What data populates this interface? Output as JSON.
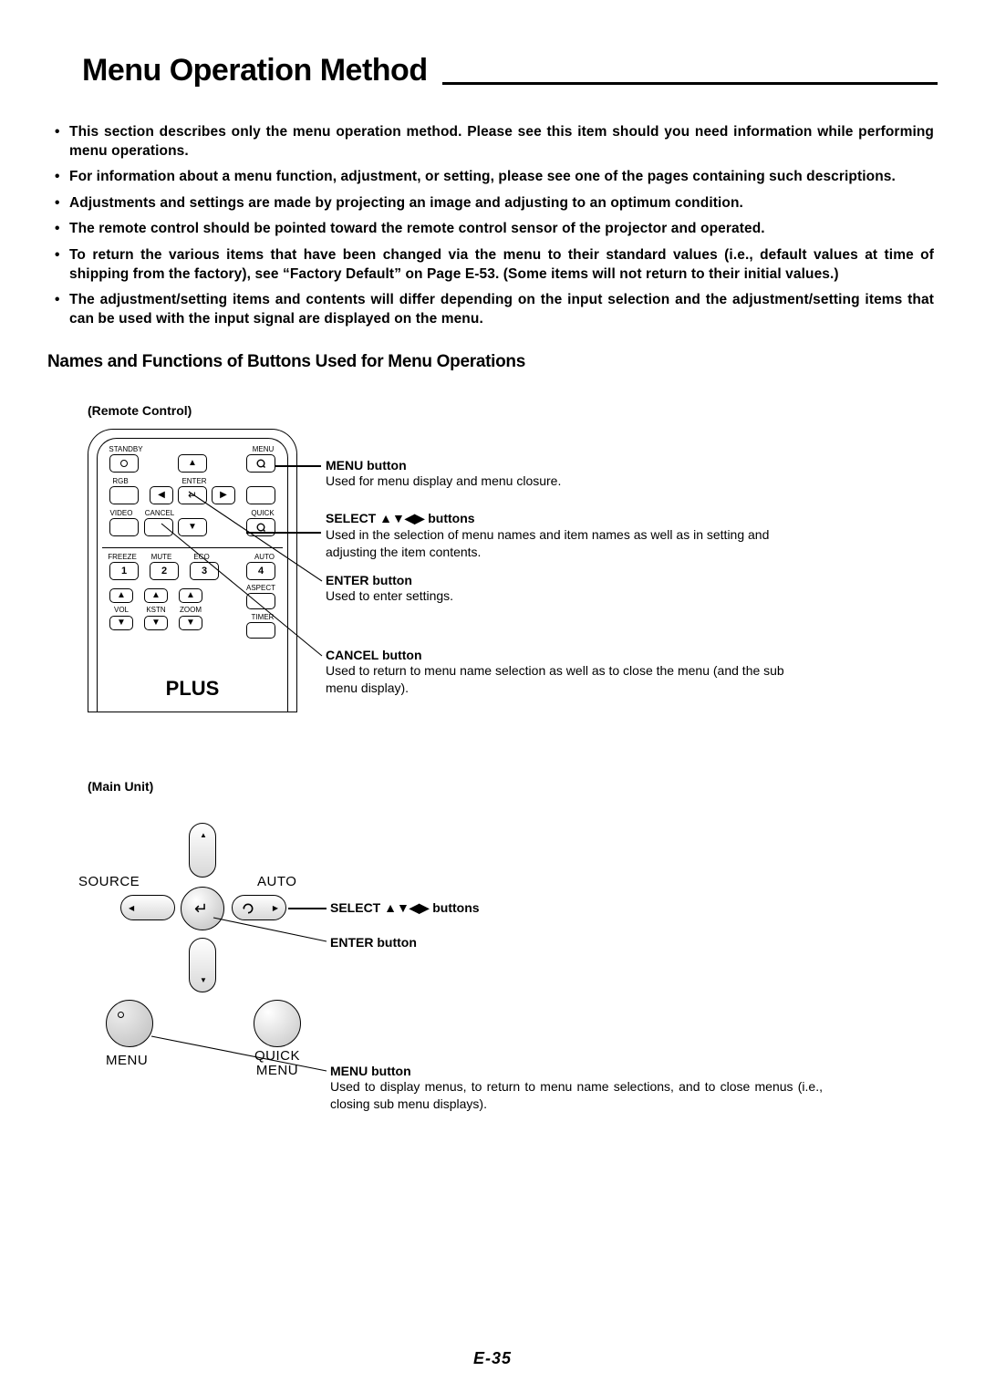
{
  "title": "Menu Operation Method",
  "bullets": [
    "This section describes only the menu operation method. Please see this item should you need information while performing menu operations.",
    "For information about a menu function, adjustment, or setting, please see one of the pages containing such descriptions.",
    "Adjustments and settings are made by projecting an image and adjusting to an optimum condition.",
    "The remote control should be pointed toward the remote control sensor of the projector and operated.",
    "To return the various items that have been changed via the menu to their standard values (i.e., default values at time of shipping from the factory), see “Factory Default” on Page E-53. (Some items will not return to their initial values.)",
    "The adjustment/setting items and contents will differ depending on the input selection and the adjustment/setting items that can be used with the input signal are displayed on the menu."
  ],
  "subhead": "Names and Functions of Buttons Used for Menu Operations",
  "remote": {
    "label": "(Remote Control)",
    "brand": "PLUS",
    "labels": {
      "standby": "STANDBY",
      "menu": "MENU",
      "rgb": "RGB",
      "enter": "ENTER",
      "video": "VIDEO",
      "cancel": "CANCEL",
      "quick": "QUICK",
      "freeze": "FREEZE",
      "mute": "MUTE",
      "eco": "ECO",
      "auto": "AUTO",
      "aspect": "ASPECT",
      "vol": "VOL",
      "kstn": "KSTN",
      "zoom": "ZOOM",
      "timer": "TIMER"
    },
    "nums": [
      "1",
      "2",
      "3",
      "4"
    ],
    "callouts": [
      {
        "hd": "MENU button",
        "bd": "Used for menu display and menu closure."
      },
      {
        "hd": "SELECT ▲▼◀▶ buttons",
        "bd": "Used in the selection of menu names and item names as well as in setting and adjusting the item contents."
      },
      {
        "hd": "ENTER button",
        "bd": "Used to enter settings."
      },
      {
        "hd": "CANCEL button",
        "bd": "Used to return to menu name selection as well as to close the menu (and the sub menu display)."
      }
    ]
  },
  "main_unit": {
    "label": "(Main Unit)",
    "labels": {
      "source": "SOURCE",
      "auto": "AUTO",
      "menu": "MENU",
      "quickmenu1": "QUICK",
      "quickmenu2": "MENU"
    },
    "callouts": [
      {
        "hd": "SELECT ▲▼◀▶ buttons",
        "bd": ""
      },
      {
        "hd": "ENTER button",
        "bd": ""
      },
      {
        "hd": "MENU button",
        "bd": "Used to display menus, to return to menu name selections, and to close menus (i.e., closing sub menu displays)."
      }
    ]
  },
  "page_number": "E-35"
}
